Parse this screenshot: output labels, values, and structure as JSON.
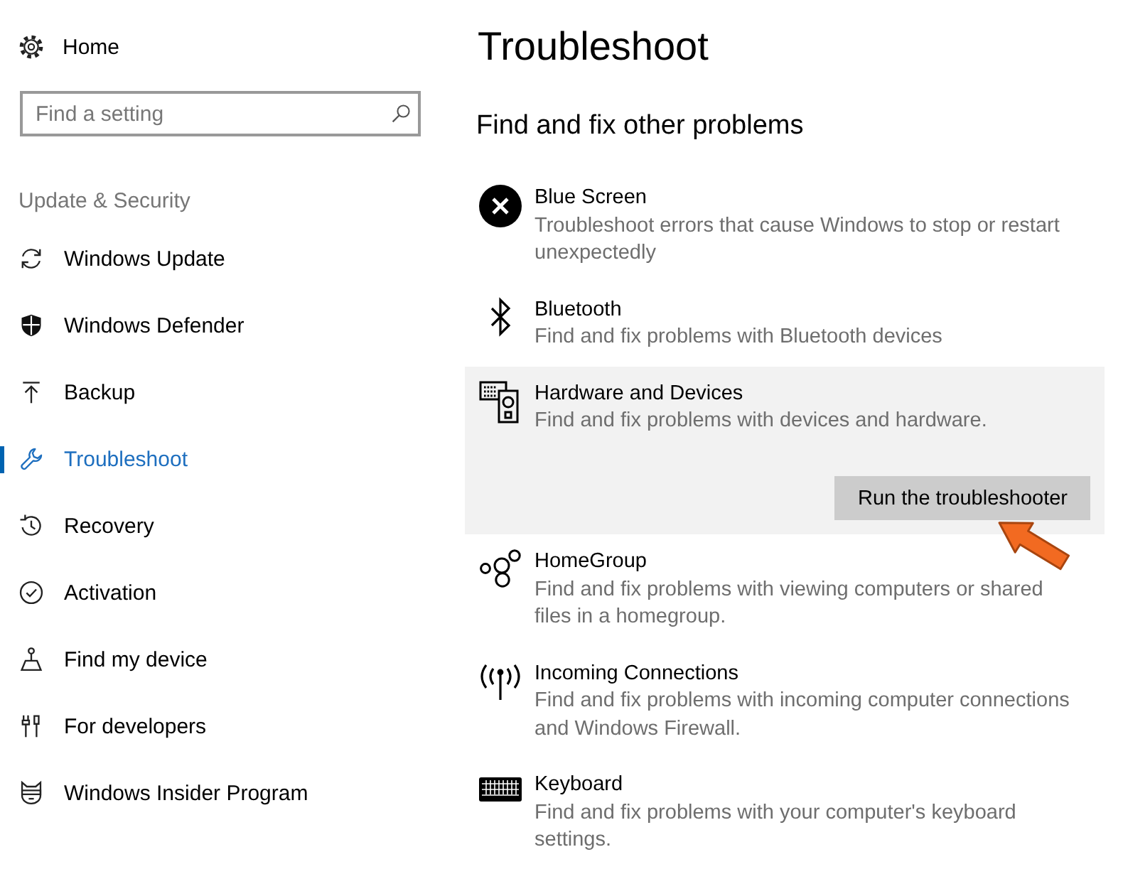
{
  "sidebar": {
    "home": {
      "label": "Home"
    },
    "search": {
      "placeholder": "Find a setting"
    },
    "section_title": "Update & Security",
    "items": [
      {
        "label": "Windows Update",
        "selected": false
      },
      {
        "label": "Windows Defender",
        "selected": false
      },
      {
        "label": "Backup",
        "selected": false
      },
      {
        "label": "Troubleshoot",
        "selected": true
      },
      {
        "label": "Recovery",
        "selected": false
      },
      {
        "label": "Activation",
        "selected": false
      },
      {
        "label": "Find my device",
        "selected": false
      },
      {
        "label": "For developers",
        "selected": false
      },
      {
        "label": "Windows Insider Program",
        "selected": false
      }
    ]
  },
  "main": {
    "title": "Troubleshoot",
    "subtitle": "Find and fix other problems",
    "troubleshooters": [
      {
        "title": "Blue Screen",
        "description": "Troubleshoot errors that cause Windows to stop or restart unexpectedly",
        "expanded": false
      },
      {
        "title": "Bluetooth",
        "description": "Find and fix problems with Bluetooth devices",
        "expanded": false
      },
      {
        "title": "Hardware and Devices",
        "description": "Find and fix problems with devices and hardware.",
        "expanded": true,
        "button": "Run the troubleshooter"
      },
      {
        "title": "HomeGroup",
        "description": "Find and fix problems with viewing computers or shared files in a homegroup.",
        "expanded": false
      },
      {
        "title": "Incoming Connections",
        "description": "Find and fix problems with incoming computer connections and Windows Firewall.",
        "expanded": false
      },
      {
        "title": "Keyboard",
        "description": "Find and fix problems with your computer's keyboard settings.",
        "expanded": false
      }
    ]
  }
}
